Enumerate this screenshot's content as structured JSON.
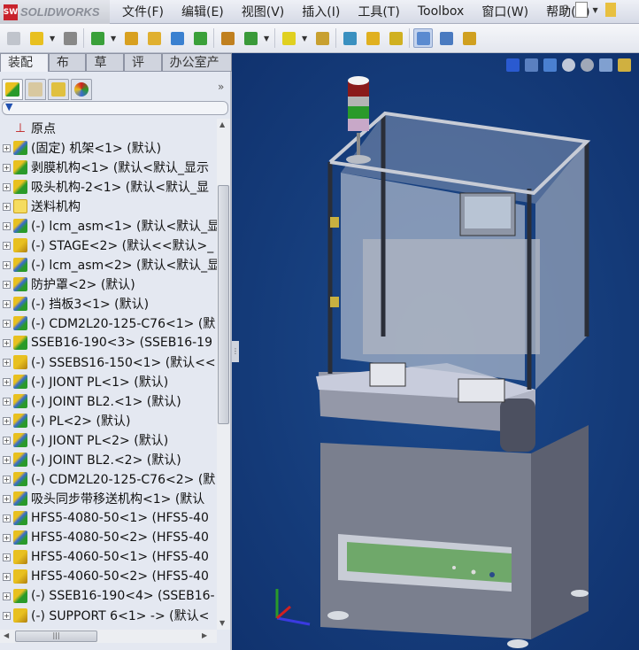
{
  "app": {
    "logo": "SOLIDWORKS"
  },
  "menu": [
    "文件(F)",
    "编辑(E)",
    "视图(V)",
    "插入(I)",
    "工具(T)",
    "Toolbox",
    "窗口(W)",
    "帮助(H)"
  ],
  "toolbar_icons": [
    "new-part-icon",
    "open-assembly-icon",
    "paperclip-icon",
    "mate-icon",
    "insert-component-icon",
    "hide-show-icon",
    "rotate-component-icon",
    "move-component-icon",
    "smart-fasteners-icon",
    "assembly-features-icon",
    "reference-geometry-icon",
    "exploded-view-icon",
    "bill-of-materials-icon",
    "interference-detection-icon",
    "clearance-check-icon",
    "measure-icon",
    "mass-properties-icon",
    "section-view-icon"
  ],
  "command_tabs": [
    {
      "label": "装配体",
      "active": true
    },
    {
      "label": "布局"
    },
    {
      "label": "草图"
    },
    {
      "label": "评估"
    },
    {
      "label": "办公室产品"
    }
  ],
  "feature_tabs": [
    "feature-manager-icon",
    "property-manager-icon",
    "configuration-manager-icon",
    "appearance-manager-icon"
  ],
  "tree": [
    {
      "label": "原点",
      "icon": "origin"
    },
    {
      "label": "(固定) 机架<1> (默认)",
      "icon": "asmb"
    },
    {
      "label": "剥膜机构<1> (默认<默认_显示",
      "icon": "asm"
    },
    {
      "label": "吸头机构-2<1> (默认<默认_显",
      "icon": "asm"
    },
    {
      "label": "送料机构",
      "icon": "folder"
    },
    {
      "label": "(-) lcm_asm<1> (默认<默认_显",
      "icon": "asmb"
    },
    {
      "label": "(-) STAGE<2> (默认<<默认>_",
      "icon": "part"
    },
    {
      "label": "(-) lcm_asm<2> (默认<默认_显",
      "icon": "asmb"
    },
    {
      "label": "防护罩<2> (默认)",
      "icon": "asmb"
    },
    {
      "label": "(-) 挡板3<1> (默认)",
      "icon": "asmb"
    },
    {
      "label": "(-) CDM2L20-125-C76<1> (默",
      "icon": "asmb"
    },
    {
      "label": "SSEB16-190<3> (SSEB16-19",
      "icon": "asm"
    },
    {
      "label": "(-) SSEBS16-150<1> (默认<<",
      "icon": "part"
    },
    {
      "label": "(-) JIONT PL<1> (默认)",
      "icon": "asmb"
    },
    {
      "label": "(-) JOINT BL2.<1> (默认)",
      "icon": "asmb"
    },
    {
      "label": "(-) PL<2> (默认)",
      "icon": "asmb"
    },
    {
      "label": "(-) JIONT PL<2> (默认)",
      "icon": "asmb"
    },
    {
      "label": "(-) JOINT BL2.<2> (默认)",
      "icon": "asmb"
    },
    {
      "label": "(-) CDM2L20-125-C76<2> (默",
      "icon": "asmb"
    },
    {
      "label": "吸头同步带移送机构<1> (默认",
      "icon": "asmb"
    },
    {
      "label": "HFS5-4080-50<1> (HFS5-40",
      "icon": "asmb"
    },
    {
      "label": "HFS5-4080-50<2> (HFS5-40",
      "icon": "asmb"
    },
    {
      "label": "HFS5-4060-50<1> (HFS5-40",
      "icon": "part"
    },
    {
      "label": "HFS5-4060-50<2> (HFS5-40",
      "icon": "part"
    },
    {
      "label": "(-) SSEB16-190<4> (SSEB16-",
      "icon": "asm"
    },
    {
      "label": "(-) SUPPORT 6<1> -> (默认<",
      "icon": "part"
    }
  ],
  "viewport": {
    "background": "#153c7c",
    "heads_up_icons": [
      "view-orientation-icon",
      "display-style-icon",
      "pan-icon",
      "zoom-to-fit-icon",
      "zoom-area-icon",
      "section-view-icon",
      "appearance-icon"
    ]
  }
}
